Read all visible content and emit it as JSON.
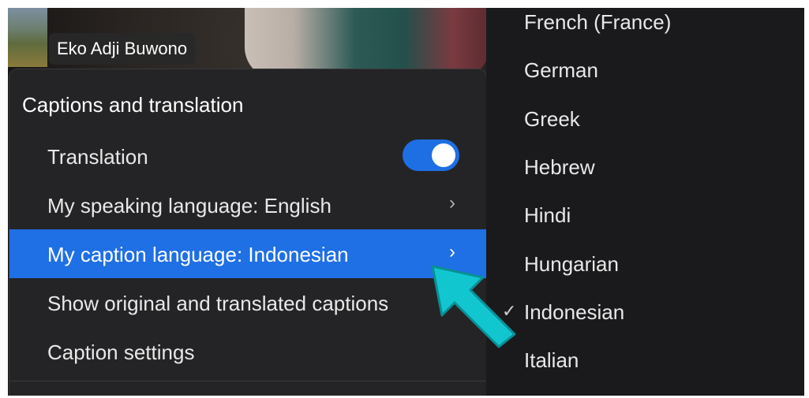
{
  "participant": {
    "name": "Eko Adji Buwono"
  },
  "menu": {
    "header": "Captions and translation",
    "translation_label": "Translation",
    "translation_enabled": true,
    "items": [
      {
        "label": "My speaking language: English",
        "chevron": "›"
      },
      {
        "label": "My caption language: Indonesian",
        "chevron": "›"
      },
      {
        "label": "Show original and translated captions"
      },
      {
        "label": "Caption settings"
      }
    ]
  },
  "submenu": {
    "languages": [
      "French (France)",
      "German",
      "Greek",
      "Hebrew",
      "Hindi",
      "Hungarian",
      "Indonesian",
      "Italian"
    ],
    "selected": "Indonesian",
    "check_glyph": "✓"
  },
  "colors": {
    "accent": "#1f6fe5",
    "annotation_arrow": "#12c6cf"
  }
}
